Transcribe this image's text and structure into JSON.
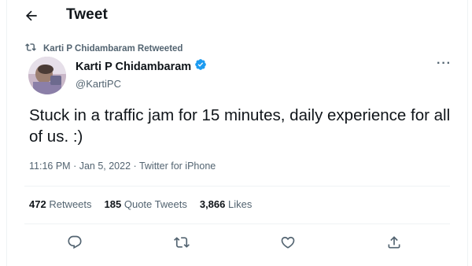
{
  "header": {
    "title": "Tweet",
    "back_icon": "arrow-left-icon"
  },
  "retweet": {
    "icon": "retweet-icon",
    "text": "Karti P Chidambaram Retweeted"
  },
  "author": {
    "name": "Karti P Chidambaram",
    "handle": "@KartiPC",
    "verified_icon": "verified-badge-icon"
  },
  "tweet": {
    "text": "Stuck in a traffic jam for 15 minutes, daily experience for all of us. :)",
    "time": "11:16 PM",
    "date": "Jan 5, 2022",
    "source": "Twitter for iPhone"
  },
  "stats": {
    "retweets_count": "472",
    "retweets_label": "Retweets",
    "quote_count": "185",
    "quote_label": "Quote Tweets",
    "likes_count": "3,866",
    "likes_label": "Likes"
  },
  "more_icon": "more-horizontal-icon",
  "actions": [
    "reply-icon",
    "retweet-icon",
    "like-icon",
    "share-icon"
  ],
  "colors": {
    "text": "#0f1419",
    "secondary": "#536471",
    "verified": "#1d9bf0",
    "border": "#eff3f4"
  }
}
